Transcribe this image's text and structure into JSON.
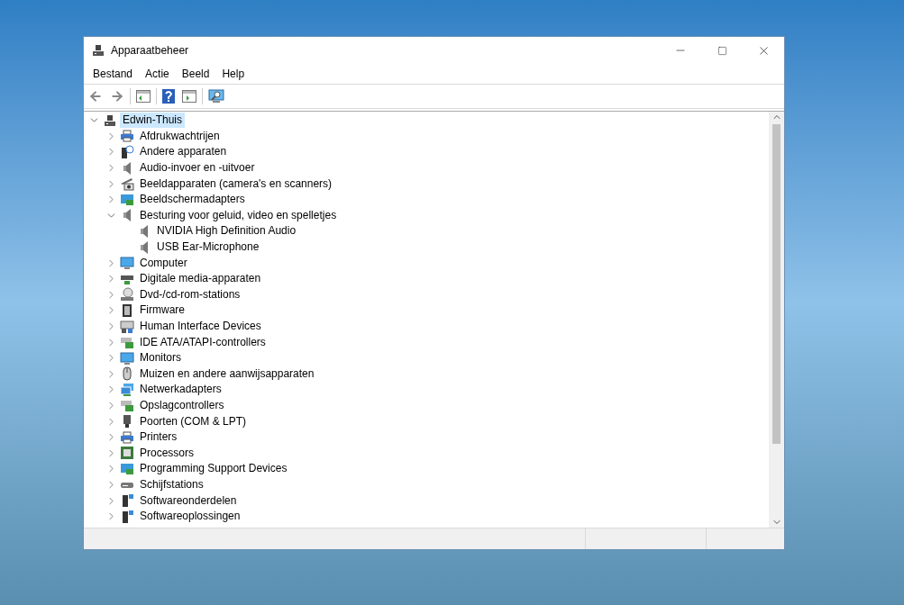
{
  "window": {
    "title": "Apparaatbeheer"
  },
  "menu": [
    "Bestand",
    "Actie",
    "Beeld",
    "Help"
  ],
  "tree": {
    "label": "Edwin-Thuis",
    "kind": "computer",
    "expanded": true,
    "selected": true,
    "children": [
      {
        "label": "Afdrukwachtrijen",
        "kind": "printer",
        "expanded": false,
        "selected": false
      },
      {
        "label": "Andere apparaten",
        "kind": "unknown",
        "expanded": false,
        "selected": false
      },
      {
        "label": "Audio-invoer en -uitvoer",
        "kind": "speaker",
        "expanded": false,
        "selected": false
      },
      {
        "label": "Beeldapparaten (camera's en scanners)",
        "kind": "camera",
        "expanded": false,
        "selected": false
      },
      {
        "label": "Beeldschermadapters",
        "kind": "adapter",
        "expanded": false,
        "selected": false
      },
      {
        "label": "Besturing voor geluid, video en spelletjes",
        "kind": "speaker",
        "expanded": true,
        "selected": false,
        "children": [
          {
            "label": "NVIDIA High Definition Audio",
            "kind": "speaker",
            "selected": false
          },
          {
            "label": "USB Ear-Microphone",
            "kind": "speaker",
            "selected": false
          }
        ]
      },
      {
        "label": "Computer",
        "kind": "monitor",
        "expanded": false,
        "selected": false
      },
      {
        "label": "Digitale media-apparaten",
        "kind": "media",
        "expanded": false,
        "selected": false
      },
      {
        "label": "Dvd-/cd-rom-stations",
        "kind": "disc",
        "expanded": false,
        "selected": false
      },
      {
        "label": "Firmware",
        "kind": "chip",
        "expanded": false,
        "selected": false
      },
      {
        "label": "Human Interface Devices",
        "kind": "keyboard",
        "expanded": false,
        "selected": false
      },
      {
        "label": "IDE ATA/ATAPI-controllers",
        "kind": "controller",
        "expanded": false,
        "selected": false
      },
      {
        "label": "Monitors",
        "kind": "monitor",
        "expanded": false,
        "selected": false
      },
      {
        "label": "Muizen en andere aanwijsapparaten",
        "kind": "mouse",
        "expanded": false,
        "selected": false
      },
      {
        "label": "Netwerkadapters",
        "kind": "network",
        "expanded": false,
        "selected": false
      },
      {
        "label": "Opslagcontrollers",
        "kind": "controller",
        "expanded": false,
        "selected": false
      },
      {
        "label": "Poorten (COM & LPT)",
        "kind": "port",
        "expanded": false,
        "selected": false
      },
      {
        "label": "Printers",
        "kind": "printer",
        "expanded": false,
        "selected": false
      },
      {
        "label": "Processors",
        "kind": "processor",
        "expanded": false,
        "selected": false
      },
      {
        "label": "Programming Support Devices",
        "kind": "adapter",
        "expanded": false,
        "selected": false
      },
      {
        "label": "Schijfstations",
        "kind": "drive",
        "expanded": false,
        "selected": false
      },
      {
        "label": "Softwareonderdelen",
        "kind": "software",
        "expanded": false,
        "selected": false
      },
      {
        "label": "Softwareoplossingen",
        "kind": "software",
        "expanded": false,
        "selected": false
      }
    ]
  }
}
